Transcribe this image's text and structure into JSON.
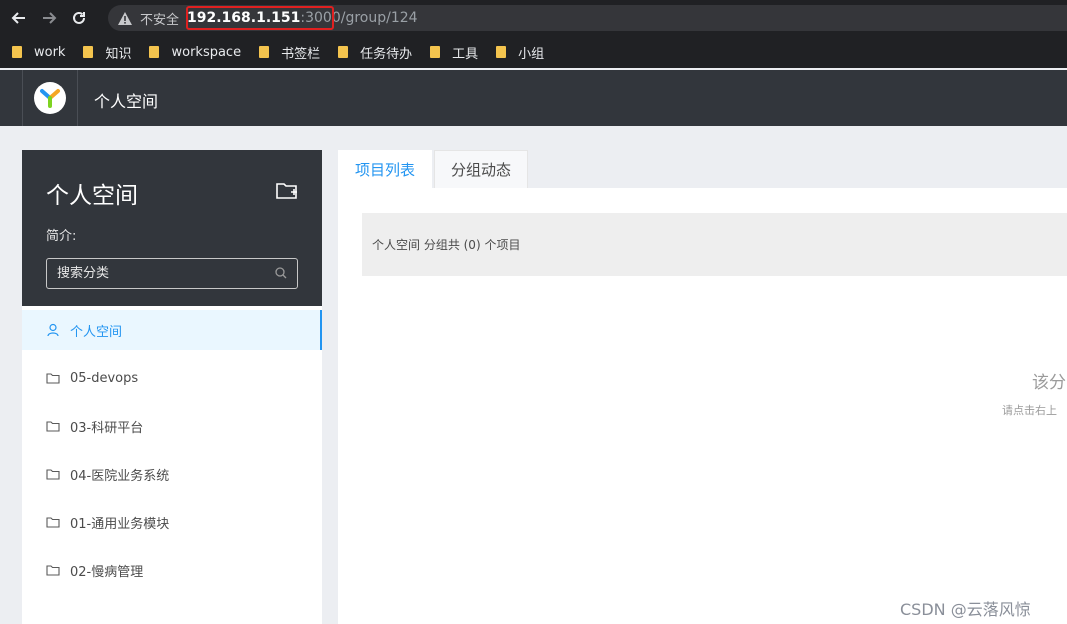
{
  "browser": {
    "insecure_label": "不安全",
    "url_host": "192.168.1.151",
    "url_port": ":3000",
    "url_path": "/group/124",
    "bookmarks": [
      "work",
      "知识",
      "workspace",
      "书签栏",
      "任务待办",
      "工具",
      "小组"
    ]
  },
  "header": {
    "title": "个人空间"
  },
  "sidebar": {
    "title": "个人空间",
    "intro_label": "简介:",
    "search_placeholder": "搜索分类",
    "items": [
      {
        "label": "个人空间",
        "icon": "user-icon",
        "active": true
      },
      {
        "label": "05-devops",
        "icon": "folder-icon"
      },
      {
        "label": "03-科研平台",
        "icon": "folder-icon"
      },
      {
        "label": "04-医院业务系统",
        "icon": "folder-icon"
      },
      {
        "label": "01-通用业务模块",
        "icon": "folder-icon"
      },
      {
        "label": "02-慢病管理",
        "icon": "folder-icon"
      }
    ]
  },
  "main": {
    "tabs": [
      {
        "label": "项目列表",
        "active": true
      },
      {
        "label": "分组动态"
      }
    ],
    "info_text": "个人空间 分组共 (0) 个项目",
    "empty_title": "该分",
    "empty_subtitle": "请点击右上"
  },
  "colors": {
    "accent": "#2395f1",
    "header_bg": "#32363c",
    "active_bg": "#eaf7ff"
  },
  "watermark": "CSDN @云落风惊"
}
